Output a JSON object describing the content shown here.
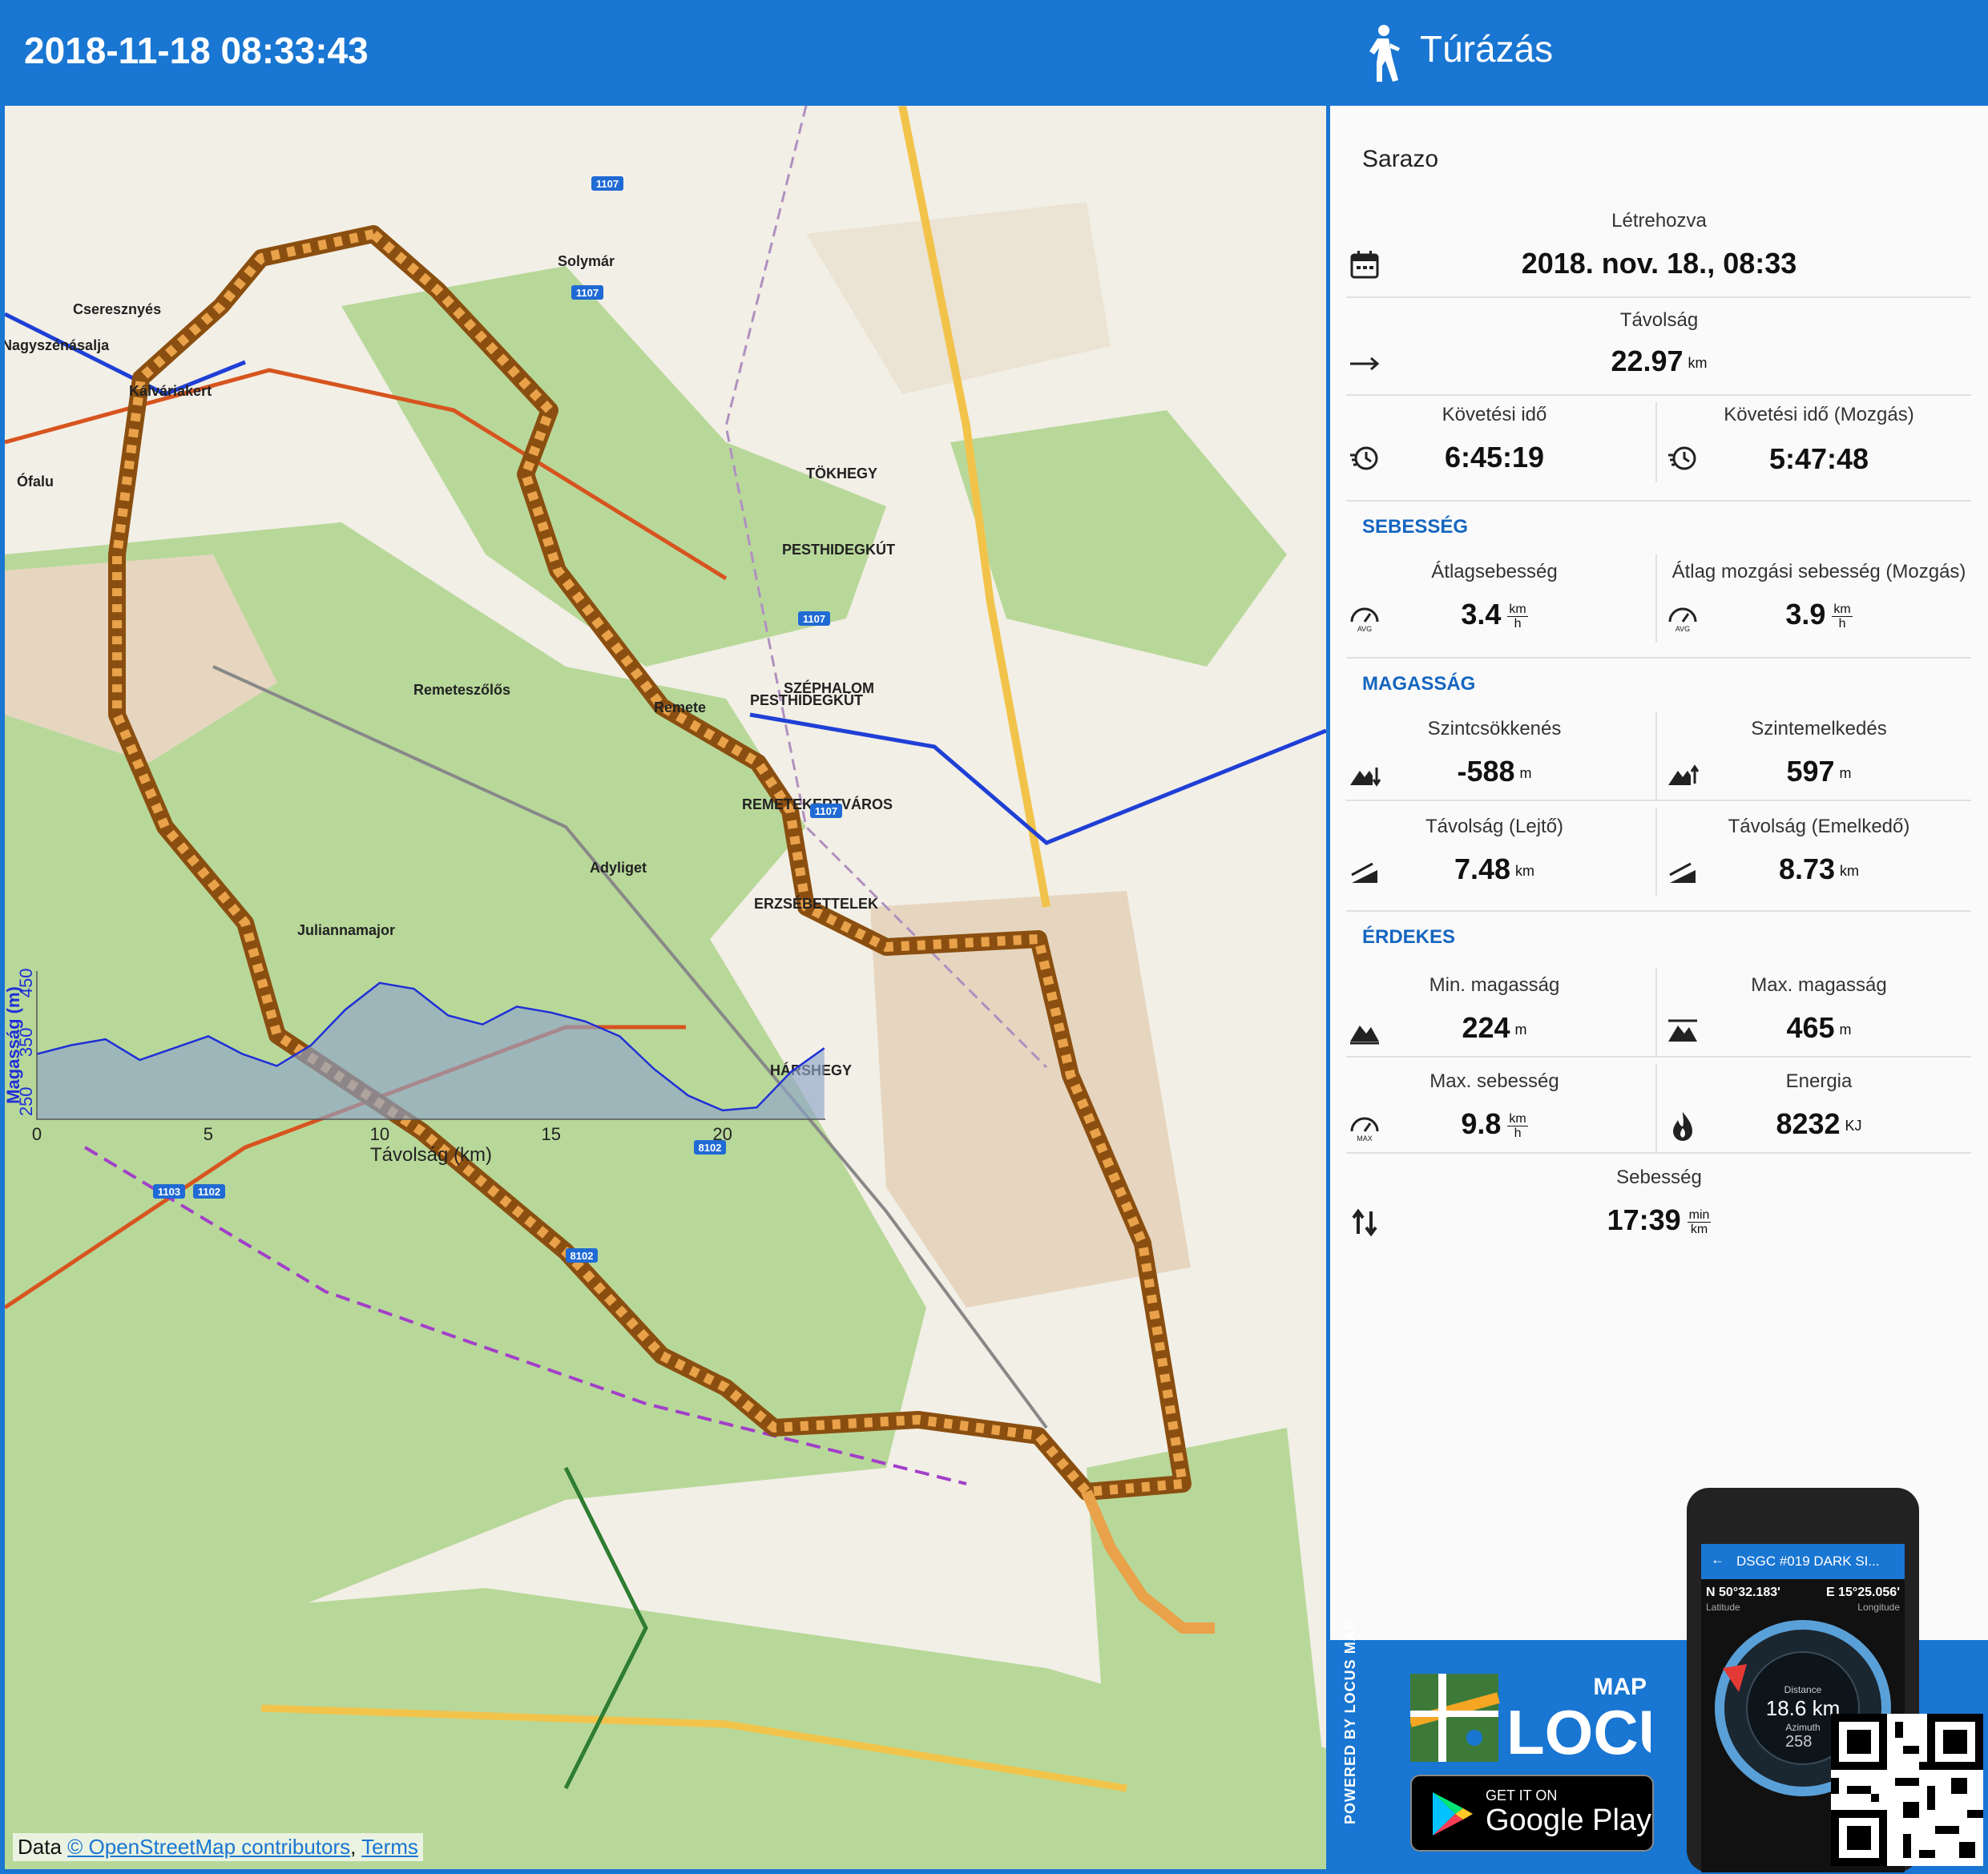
{
  "header": {
    "datetime": "2018-11-18 08:33:43"
  },
  "activity": {
    "name": "Túrázás",
    "icon": "hiking-icon"
  },
  "track": {
    "name": "Sarazo"
  },
  "stats": {
    "created": {
      "label": "Létrehozva",
      "value": "2018. nov. 18., 08:33"
    },
    "distance": {
      "label": "Távolság",
      "value": "22.97",
      "unit": "km"
    },
    "track_time": {
      "label": "Követési idő",
      "value": "6:45:19"
    },
    "track_time_moving": {
      "label": "Követési idő (Mozgás)",
      "value": "5:47:48"
    },
    "speed_section": "SEBESSÉG",
    "avg_speed": {
      "label": "Átlagsebesség",
      "value": "3.4",
      "unit_top": "km",
      "unit_bottom": "h",
      "icon_text": "AVG"
    },
    "avg_moving_speed": {
      "label": "Átlag mozgási sebesség (Mozgás)",
      "value": "3.9",
      "unit_top": "km",
      "unit_bottom": "h",
      "icon_text": "AVG"
    },
    "elevation_section": "MAGASSÁG",
    "descent": {
      "label": "Szintcsökkenés",
      "value": "-588",
      "unit": "m"
    },
    "ascent": {
      "label": "Szintemelkedés",
      "value": "597",
      "unit": "m"
    },
    "dist_down": {
      "label": "Távolság (Lejtő)",
      "value": "7.48",
      "unit": "km"
    },
    "dist_up": {
      "label": "Távolság (Emelkedő)",
      "value": "8.73",
      "unit": "km"
    },
    "interesting_section": "ÉRDEKES",
    "min_elev": {
      "label": "Min. magasság",
      "value": "224",
      "unit": "m"
    },
    "max_elev": {
      "label": "Max. magasság",
      "value": "465",
      "unit": "m"
    },
    "max_speed": {
      "label": "Max. sebesség",
      "value": "9.8",
      "unit_top": "km",
      "unit_bottom": "h",
      "icon_text": "MAX"
    },
    "energy": {
      "label": "Energia",
      "value": "8232",
      "unit": "KJ"
    },
    "pace": {
      "label": "Sebesség",
      "value": "17:39",
      "unit_top": "min",
      "unit_bottom": "km"
    }
  },
  "map": {
    "places": [
      "Solymár",
      "Cseresznyés",
      "Nagyszénásalja",
      "Kálváriakert",
      "Ófalu",
      "Remeteszőlős",
      "Remete",
      "Juliannamajor",
      "Adyliget",
      "TÖKHEGY",
      "PESTHIDEGKÚT",
      "SZÉPHALOM",
      "PESTHIDEGKÚT",
      "REMETEKERTVÁROS",
      "ERZSÉBETTELEK",
      "HÁRSHEGY"
    ],
    "roads": [
      "1107",
      "1107",
      "1107",
      "1103",
      "1102",
      "8102",
      "8102",
      "1107"
    ],
    "attribution_prefix": "Data",
    "attribution_link": "© OpenStreetMap contributors",
    "attribution_sep": ",",
    "attribution_terms": "Terms"
  },
  "chart_data": {
    "type": "area",
    "xlabel": "Távolság (km)",
    "ylabel": "Magasság (m)",
    "x_ticks": [
      "0",
      "5",
      "10",
      "15",
      "20"
    ],
    "y_ticks": [
      "250",
      "350",
      "450"
    ],
    "xlim": [
      0,
      23
    ],
    "ylim": [
      220,
      470
    ],
    "x": [
      0,
      1,
      2,
      3,
      4,
      5,
      6,
      7,
      8,
      9,
      10,
      11,
      12,
      13,
      14,
      15,
      16,
      17,
      18,
      19,
      20,
      21,
      22,
      22.97
    ],
    "y": [
      330,
      345,
      355,
      320,
      340,
      360,
      330,
      310,
      345,
      405,
      450,
      440,
      395,
      380,
      410,
      400,
      385,
      360,
      305,
      260,
      235,
      240,
      300,
      340
    ]
  },
  "promo": {
    "powered_by": "POWERED BY LOCUS MAP",
    "logo_map": "MAP",
    "logo_locus": "LOCUS",
    "gplay_get": "GET IT ON",
    "gplay_store": "Google Play",
    "phone_title": "DSGC #019 DARK SI...",
    "phone_lat": "N 50°32.183'",
    "phone_lon": "E 15°25.056'",
    "phone_lat_label": "Latitude",
    "phone_lon_label": "Longitude",
    "phone_distance_label": "Distance",
    "phone_distance": "18.6 km",
    "phone_azimuth_label": "Azimuth",
    "phone_azimuth": "258"
  },
  "colors": {
    "brand": "#1976d2",
    "section": "#1565c0",
    "track": "#e07a1f",
    "forest": "#b8d89a",
    "elevation_fill": "#8fa4c9"
  }
}
